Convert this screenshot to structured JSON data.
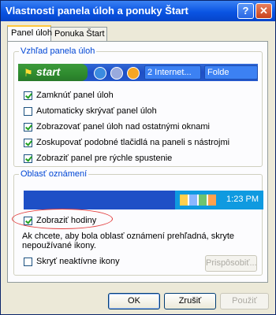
{
  "window": {
    "title": "Vlastnosti panela úloh a ponuky Štart"
  },
  "tabs": [
    "Panel úloh",
    "Ponuka Štart"
  ],
  "group_taskbar": {
    "label": "Vzhľad panela úloh",
    "preview": {
      "start": "start",
      "task1": "2 Internet...",
      "task2": "Folde"
    },
    "options": [
      {
        "label": "Zamknúť panel úloh",
        "checked": true
      },
      {
        "label": "Automaticky skrývať panel úloh",
        "checked": false
      },
      {
        "label": "Zobrazovať panel úloh nad ostatnými oknami",
        "checked": true
      },
      {
        "label": "Zoskupovať podobné tlačidlá na paneli s nástrojmi",
        "checked": true
      },
      {
        "label": "Zobraziť panel pre rýchle spustenie",
        "checked": true
      }
    ]
  },
  "group_notification": {
    "label": "Oblasť oznámení",
    "clock": "1:23 PM",
    "show_clock": {
      "label": "Zobraziť hodiny",
      "checked": true
    },
    "description": "Ak chcete, aby bola oblasť oznámení prehľadná, skryte nepoužívané ikony.",
    "hide_inactive": {
      "label": "Skryť neaktívne ikony",
      "checked": false
    },
    "customize_label": "Prispôsobiť..."
  },
  "buttons": {
    "ok": "OK",
    "cancel": "Zrušiť",
    "apply": "Použiť"
  }
}
